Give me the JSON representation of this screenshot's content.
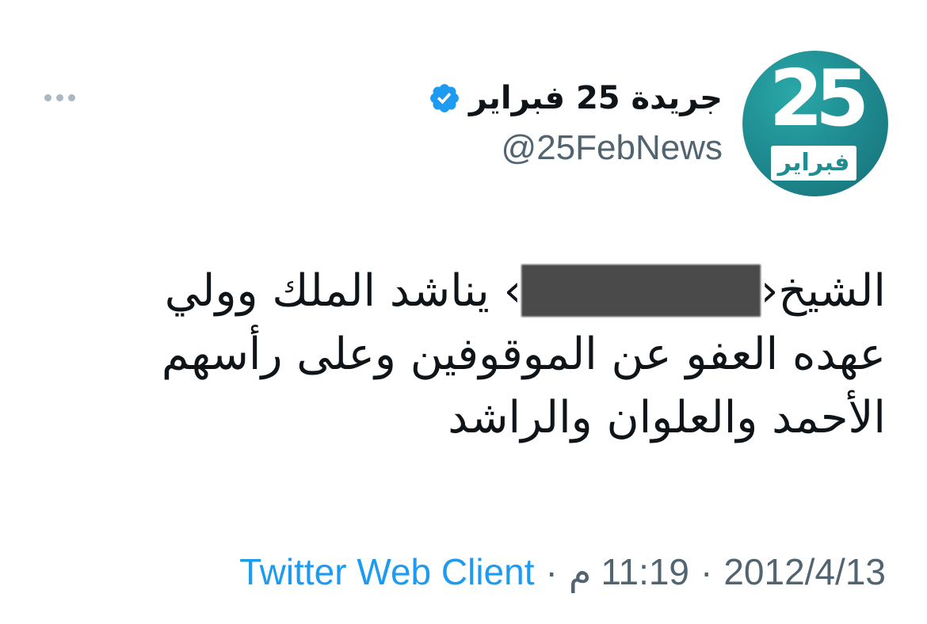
{
  "account": {
    "display_name": "جريدة 25 فبراير",
    "handle": "@25FebNews",
    "verified": true,
    "avatar": {
      "number": "25",
      "label": "فبراير",
      "colors": {
        "primary": "#1f8d92",
        "text": "#ffffff"
      }
    }
  },
  "tweet": {
    "text_before_redaction": "الشيخ‹",
    "text_after_redaction": "› يناشد الملك وولي عهده العفو عن الموقوفين وعلى رأسهم الأحمد والعلوان والراشد"
  },
  "meta": {
    "date": "2012/4/13",
    "time": "11:19",
    "period": "م",
    "separator": "·",
    "client": "Twitter Web Client"
  },
  "icons": {
    "more": "more-horizontal-icon",
    "verified": "verified-badge-icon"
  },
  "colors": {
    "accent": "#1d9bf0",
    "muted": "#536471",
    "text": "#0f1419"
  }
}
